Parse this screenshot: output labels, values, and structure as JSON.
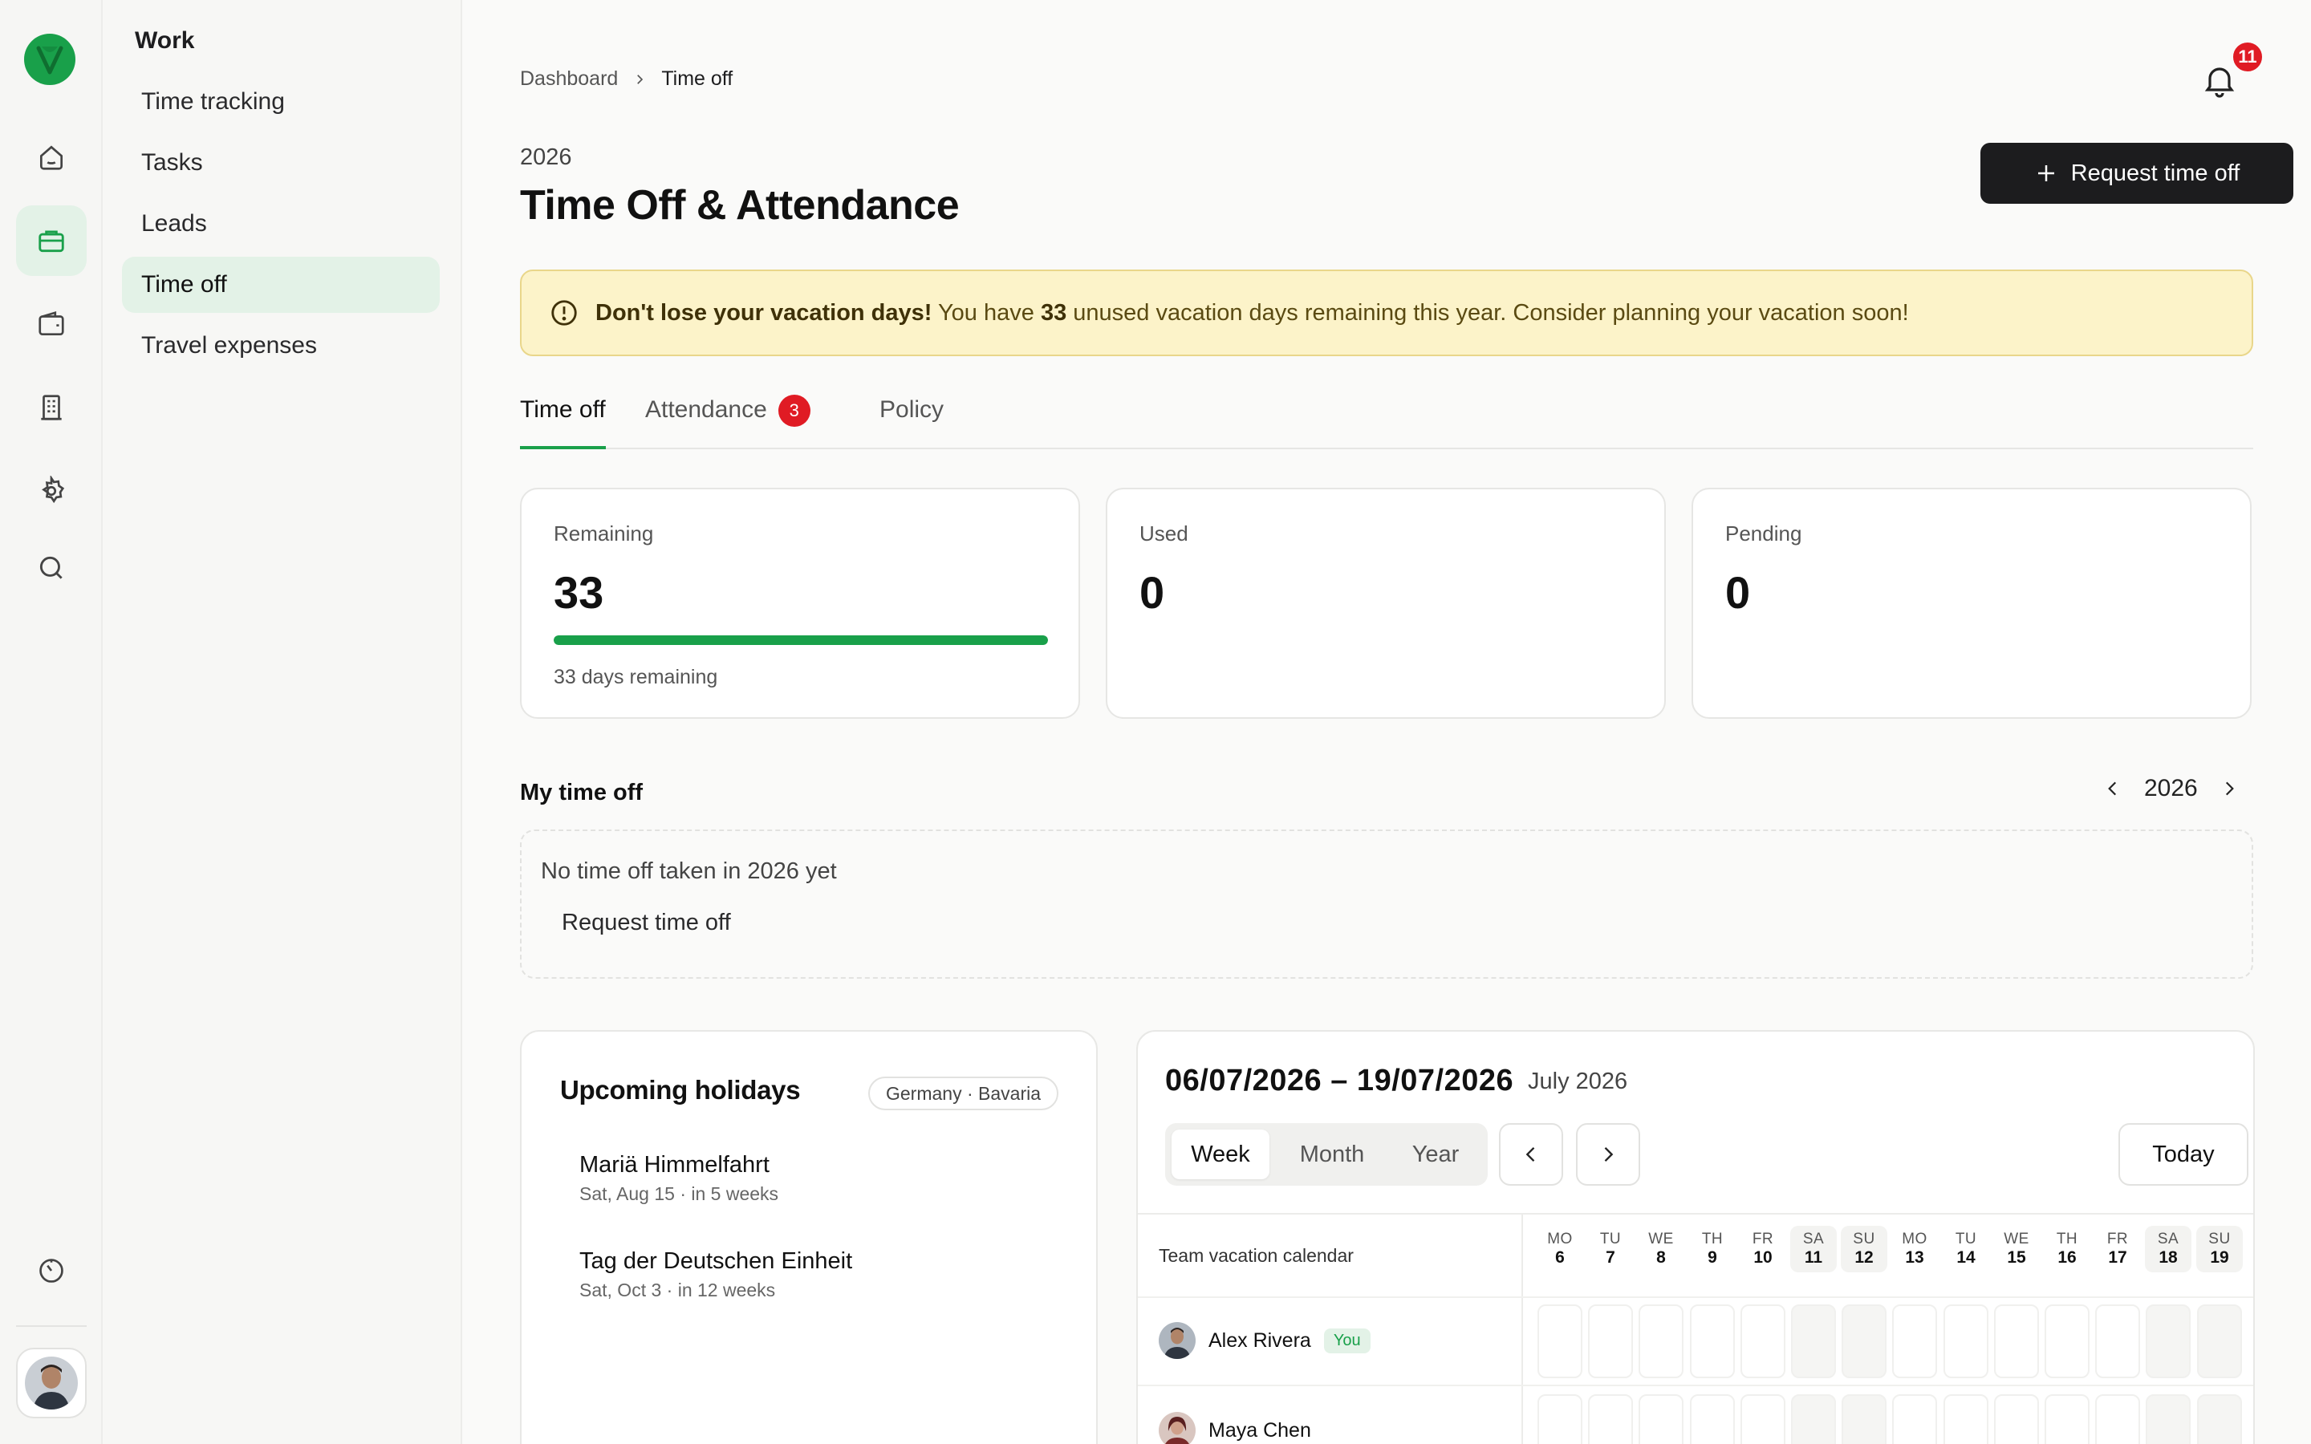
{
  "sidebar": {
    "section_title": "Work",
    "items": [
      {
        "label": "Time tracking"
      },
      {
        "label": "Tasks"
      },
      {
        "label": "Leads"
      },
      {
        "label": "Time off",
        "active": true
      },
      {
        "label": "Travel expenses"
      }
    ]
  },
  "rail": {
    "icons": [
      "home-icon",
      "briefcase-icon",
      "wallet-icon",
      "building-icon",
      "gear-icon",
      "search-icon",
      "timer-icon"
    ],
    "active": "briefcase-icon"
  },
  "breadcrumb": {
    "root": "Dashboard",
    "current": "Time off"
  },
  "notifications": {
    "count": "11"
  },
  "header": {
    "year": "2026",
    "title": "Time Off & Attendance",
    "request_button": "Request time off"
  },
  "alert": {
    "bold": "Don't lose your vacation days!",
    "pre": "You have",
    "days": "33",
    "post": "unused vacation days remaining this year. Consider planning your vacation soon!"
  },
  "tabs": [
    {
      "label": "Time off",
      "active": true
    },
    {
      "label": "Attendance",
      "badge": "3"
    },
    {
      "label": "Policy"
    }
  ],
  "stats": {
    "remaining": {
      "label": "Remaining",
      "value": "33",
      "sub": "33 days remaining",
      "progress": 1.0
    },
    "used": {
      "label": "Used",
      "value": "0"
    },
    "pending": {
      "label": "Pending",
      "value": "0"
    }
  },
  "my_time_off": {
    "title": "My time off",
    "year": "2026",
    "empty_text": "No time off taken in 2026 yet",
    "empty_link": "Request time off"
  },
  "holidays": {
    "title": "Upcoming holidays",
    "region": "Germany · Bavaria",
    "items": [
      {
        "name": "Mariä Himmelfahrt",
        "date": "Sat, Aug 15 · in 5 weeks"
      },
      {
        "name": "Tag der Deutschen Einheit",
        "date": "Sat, Oct 3 · in 12 weeks"
      }
    ]
  },
  "calendar": {
    "range": "06/07/2026 – 19/07/2026",
    "month": "July 2026",
    "views": [
      "Week",
      "Month",
      "Year"
    ],
    "active_view": "Week",
    "today": "Today",
    "team_label": "Team vacation calendar",
    "days": [
      {
        "dow": "MO",
        "num": "6"
      },
      {
        "dow": "TU",
        "num": "7"
      },
      {
        "dow": "WE",
        "num": "8"
      },
      {
        "dow": "TH",
        "num": "9"
      },
      {
        "dow": "FR",
        "num": "10"
      },
      {
        "dow": "SA",
        "num": "11",
        "weekend": true
      },
      {
        "dow": "SU",
        "num": "12",
        "weekend": true
      },
      {
        "dow": "MO",
        "num": "13"
      },
      {
        "dow": "TU",
        "num": "14"
      },
      {
        "dow": "WE",
        "num": "15"
      },
      {
        "dow": "TH",
        "num": "16"
      },
      {
        "dow": "FR",
        "num": "17"
      },
      {
        "dow": "SA",
        "num": "18",
        "weekend": true
      },
      {
        "dow": "SU",
        "num": "19",
        "weekend": true
      }
    ],
    "people": [
      {
        "name": "Alex Rivera",
        "badge": "You"
      },
      {
        "name": "Maya Chen"
      }
    ]
  },
  "colors": {
    "accent": "#19a04a",
    "badge": "#e01b24",
    "alert_bg": "#fcf3c9"
  }
}
